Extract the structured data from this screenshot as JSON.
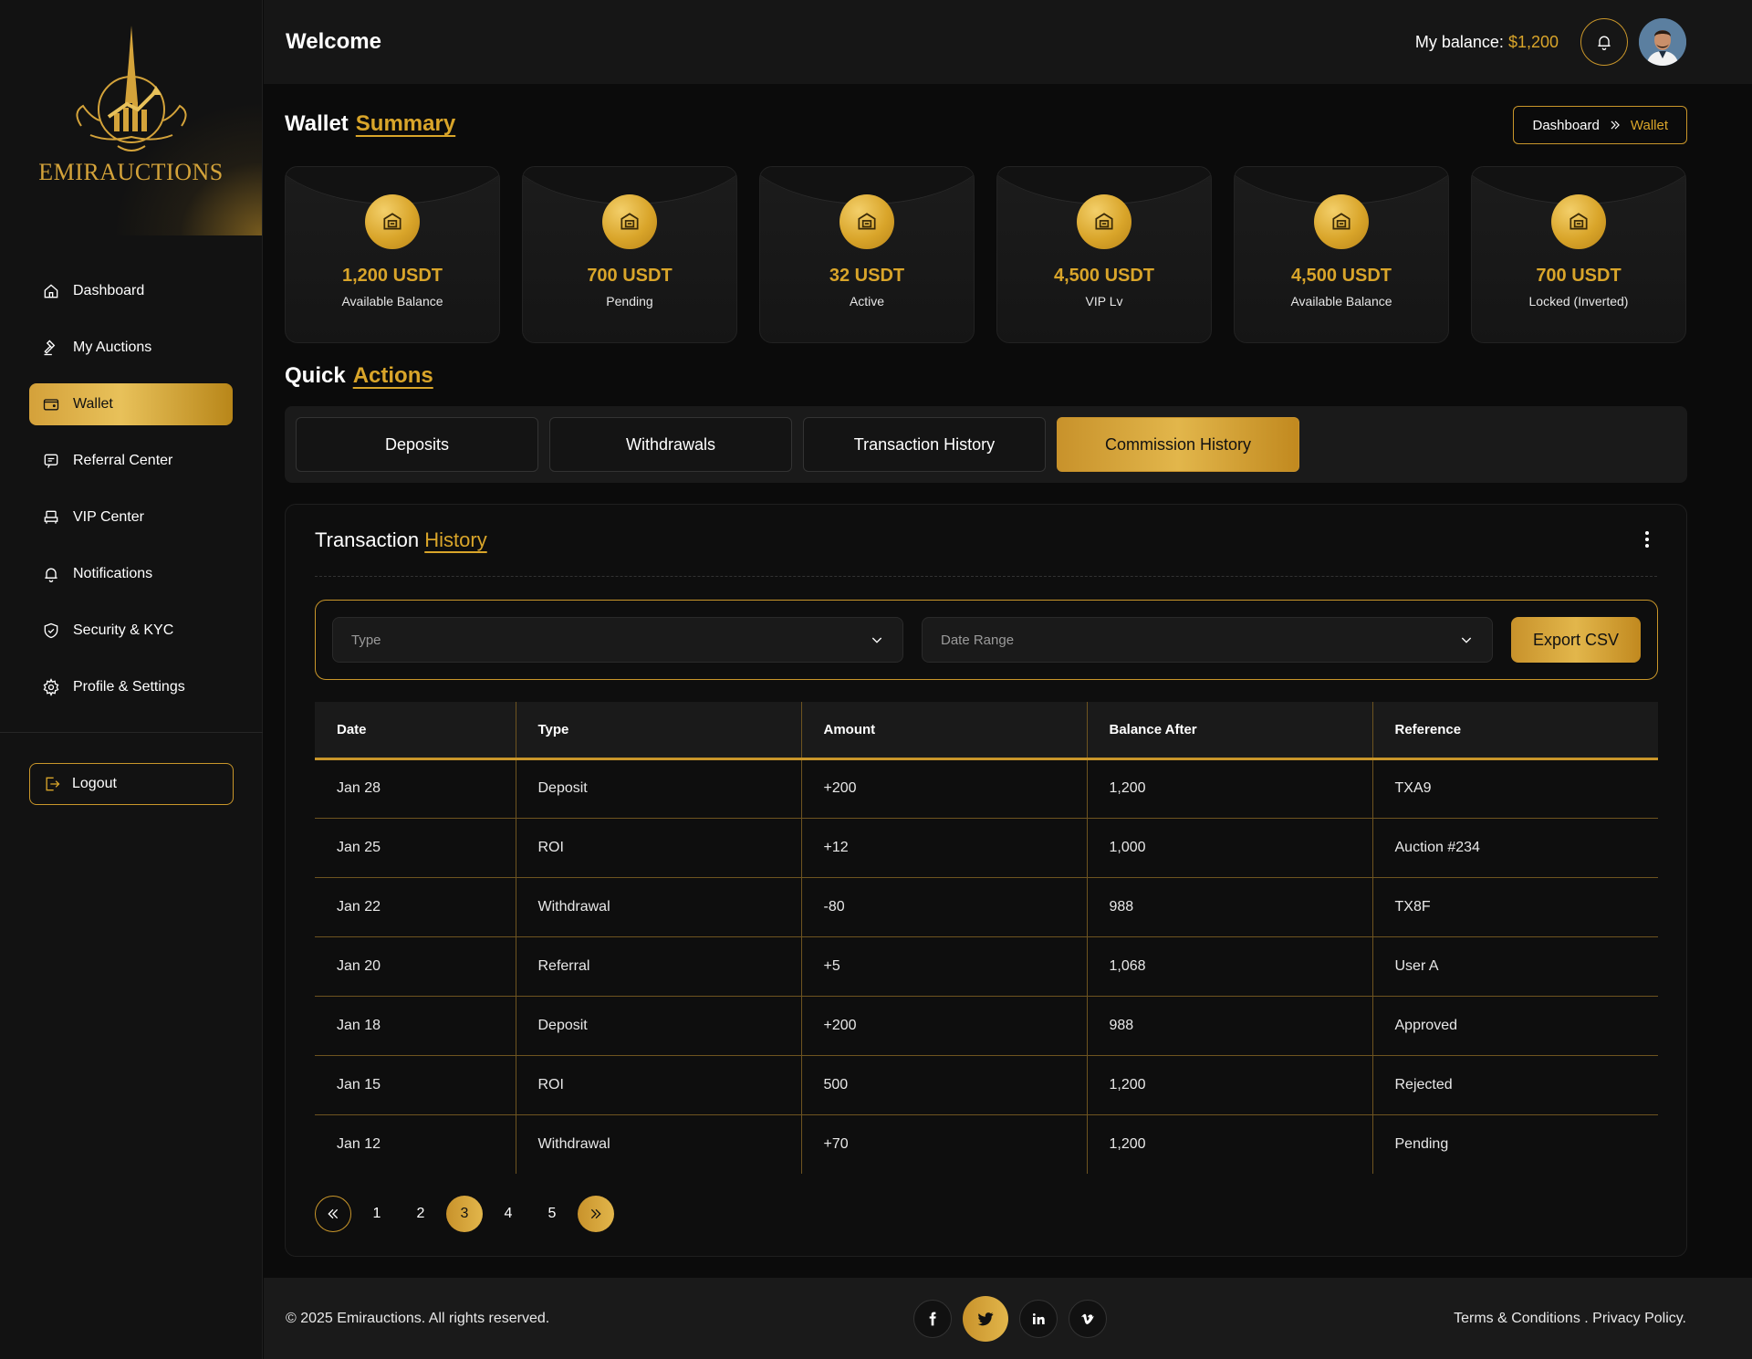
{
  "brand": {
    "name": "EMIRAUCTIONS"
  },
  "sidebar": {
    "items": [
      {
        "label": "Dashboard",
        "icon": "home-icon",
        "active": false
      },
      {
        "label": "My Auctions",
        "icon": "gavel-icon",
        "active": false
      },
      {
        "label": "Wallet",
        "icon": "wallet-icon",
        "active": true
      },
      {
        "label": "Referral Center",
        "icon": "referral-icon",
        "active": false
      },
      {
        "label": "VIP Center",
        "icon": "vip-icon",
        "active": false
      },
      {
        "label": "Notifications",
        "icon": "bell-icon",
        "active": false
      },
      {
        "label": "Security & KYC",
        "icon": "shield-icon",
        "active": false
      },
      {
        "label": "Profile & Settings",
        "icon": "gear-icon",
        "active": false
      }
    ],
    "logout": "Logout"
  },
  "header": {
    "title": "Welcome",
    "balance_label": "My balance:",
    "balance_value": "$1,200"
  },
  "summary": {
    "title_a": "Wallet",
    "title_b": "Summary",
    "breadcrumb": {
      "root": "Dashboard",
      "current": "Wallet"
    },
    "cards": [
      {
        "value": "1,200 USDT",
        "label": "Available Balance"
      },
      {
        "value": "700 USDT",
        "label": "Pending"
      },
      {
        "value": "32 USDT",
        "label": "Active"
      },
      {
        "value": "4,500 USDT",
        "label": "VIP Lv"
      },
      {
        "value": "4,500 USDT",
        "label": "Available Balance"
      },
      {
        "value": "700 USDT",
        "label": "Locked (Inverted)"
      }
    ]
  },
  "quick_actions": {
    "title_a": "Quick",
    "title_b": "Actions",
    "tabs": [
      {
        "label": "Deposits",
        "active": false
      },
      {
        "label": "Withdrawals",
        "active": false
      },
      {
        "label": "Transaction History",
        "active": false
      },
      {
        "label": "Commission History",
        "active": true
      }
    ]
  },
  "history": {
    "title_a": "Transaction",
    "title_b": "History",
    "filters": {
      "type_placeholder": "Type",
      "date_placeholder": "Date Range",
      "export": "Export CSV"
    },
    "columns": [
      "Date",
      "Type",
      "Amount",
      "Balance After",
      "Reference"
    ],
    "rows": [
      [
        "Jan 28",
        "Deposit",
        "+200",
        "1,200",
        "TXA9"
      ],
      [
        "Jan 25",
        "ROI",
        "+12",
        "1,000",
        "Auction #234"
      ],
      [
        "Jan 22",
        "Withdrawal",
        "-80",
        "988",
        "TX8F"
      ],
      [
        "Jan 20",
        "Referral",
        "+5",
        "1,068",
        "User A"
      ],
      [
        "Jan 18",
        "Deposit",
        "+200",
        "988",
        "Approved"
      ],
      [
        "Jan 15",
        "ROI",
        "500",
        "1,200",
        "Rejected"
      ],
      [
        "Jan 12",
        "Withdrawal",
        "+70",
        "1,200",
        "Pending"
      ]
    ],
    "pagination": {
      "pages": [
        "1",
        "2",
        "3",
        "4",
        "5"
      ],
      "current": "3"
    }
  },
  "footer": {
    "copyright": "© 2025 Emirauctions. All rights reserved.",
    "links": "Terms & Conditions . Privacy Policy.",
    "socials": [
      "facebook-icon",
      "twitter-icon",
      "linkedin-icon",
      "vimeo-icon"
    ]
  },
  "colors": {
    "accent": "#d9a52a",
    "background": "#0b0b0b",
    "surface": "#1a1a1a"
  }
}
